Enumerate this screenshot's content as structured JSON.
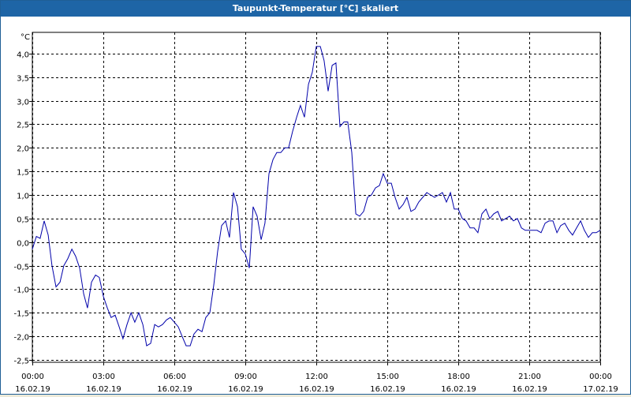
{
  "window": {
    "title": "Taupunkt-Temperatur [°C] skaliert"
  },
  "chart_data": {
    "type": "line",
    "title": "Taupunkt-Temperatur [°C] skaliert",
    "y_unit_label": "°C",
    "ylim": [
      -2.55,
      4.45
    ],
    "xlim_hours": [
      0,
      24
    ],
    "grid": true,
    "grid_style": "dashed",
    "line_color": "#0000aa",
    "y_ticks": [
      {
        "value": 4.0,
        "label": "4,0"
      },
      {
        "value": 3.5,
        "label": "3,5"
      },
      {
        "value": 3.0,
        "label": "3,0"
      },
      {
        "value": 2.5,
        "label": "2,5"
      },
      {
        "value": 2.0,
        "label": "2,0"
      },
      {
        "value": 1.5,
        "label": "1,5"
      },
      {
        "value": 1.0,
        "label": "1,0"
      },
      {
        "value": 0.5,
        "label": "0,5"
      },
      {
        "value": 0.0,
        "label": "0,0"
      },
      {
        "value": -0.5,
        "label": "-0,5"
      },
      {
        "value": -1.0,
        "label": "-1,0"
      },
      {
        "value": -1.5,
        "label": "-1,5"
      },
      {
        "value": -2.0,
        "label": "-2,0"
      },
      {
        "value": -2.5,
        "label": "-2,5"
      }
    ],
    "x_ticks": [
      {
        "hour": 0,
        "time": "00:00",
        "date": "16.02.19"
      },
      {
        "hour": 3,
        "time": "03:00",
        "date": "16.02.19"
      },
      {
        "hour": 6,
        "time": "06:00",
        "date": "16.02.19"
      },
      {
        "hour": 9,
        "time": "09:00",
        "date": "16.02.19"
      },
      {
        "hour": 12,
        "time": "12:00",
        "date": "16.02.19"
      },
      {
        "hour": 15,
        "time": "15:00",
        "date": "16.02.19"
      },
      {
        "hour": 18,
        "time": "18:00",
        "date": "16.02.19"
      },
      {
        "hour": 21,
        "time": "21:00",
        "date": "16.02.19"
      },
      {
        "hour": 24,
        "time": "00:00",
        "date": "17.02.19"
      }
    ],
    "series": [
      {
        "points": [
          [
            0.0,
            -0.15
          ],
          [
            0.17,
            0.12
          ],
          [
            0.33,
            0.08
          ],
          [
            0.5,
            0.45
          ],
          [
            0.67,
            0.15
          ],
          [
            0.83,
            -0.5
          ],
          [
            1.0,
            -0.95
          ],
          [
            1.17,
            -0.85
          ],
          [
            1.33,
            -0.5
          ],
          [
            1.5,
            -0.35
          ],
          [
            1.67,
            -0.15
          ],
          [
            1.83,
            -0.3
          ],
          [
            2.0,
            -0.55
          ],
          [
            2.17,
            -1.1
          ],
          [
            2.33,
            -1.4
          ],
          [
            2.5,
            -0.85
          ],
          [
            2.67,
            -0.7
          ],
          [
            2.83,
            -0.75
          ],
          [
            3.0,
            -1.15
          ],
          [
            3.17,
            -1.4
          ],
          [
            3.33,
            -1.6
          ],
          [
            3.5,
            -1.55
          ],
          [
            3.67,
            -1.8
          ],
          [
            3.83,
            -2.05
          ],
          [
            4.0,
            -1.75
          ],
          [
            4.17,
            -1.5
          ],
          [
            4.33,
            -1.7
          ],
          [
            4.5,
            -1.5
          ],
          [
            4.67,
            -1.75
          ],
          [
            4.83,
            -2.2
          ],
          [
            5.0,
            -2.15
          ],
          [
            5.17,
            -1.75
          ],
          [
            5.33,
            -1.8
          ],
          [
            5.5,
            -1.75
          ],
          [
            5.67,
            -1.65
          ],
          [
            5.83,
            -1.6
          ],
          [
            6.0,
            -1.7
          ],
          [
            6.17,
            -1.8
          ],
          [
            6.33,
            -2.0
          ],
          [
            6.5,
            -2.2
          ],
          [
            6.67,
            -2.2
          ],
          [
            6.83,
            -1.95
          ],
          [
            7.0,
            -1.85
          ],
          [
            7.17,
            -1.9
          ],
          [
            7.33,
            -1.6
          ],
          [
            7.5,
            -1.5
          ],
          [
            7.67,
            -0.9
          ],
          [
            7.83,
            -0.2
          ],
          [
            8.0,
            0.35
          ],
          [
            8.17,
            0.45
          ],
          [
            8.33,
            0.1
          ],
          [
            8.5,
            1.05
          ],
          [
            8.67,
            0.75
          ],
          [
            8.83,
            -0.15
          ],
          [
            9.0,
            -0.25
          ],
          [
            9.17,
            -0.55
          ],
          [
            9.33,
            0.75
          ],
          [
            9.5,
            0.55
          ],
          [
            9.67,
            0.05
          ],
          [
            9.83,
            0.4
          ],
          [
            10.0,
            1.45
          ],
          [
            10.17,
            1.75
          ],
          [
            10.33,
            1.9
          ],
          [
            10.5,
            1.9
          ],
          [
            10.67,
            2.0
          ],
          [
            10.83,
            2.0
          ],
          [
            11.0,
            2.35
          ],
          [
            11.17,
            2.65
          ],
          [
            11.33,
            2.9
          ],
          [
            11.5,
            2.65
          ],
          [
            11.67,
            3.35
          ],
          [
            11.83,
            3.6
          ],
          [
            12.0,
            4.15
          ],
          [
            12.17,
            4.15
          ],
          [
            12.33,
            3.85
          ],
          [
            12.5,
            3.2
          ],
          [
            12.67,
            3.75
          ],
          [
            12.83,
            3.8
          ],
          [
            13.0,
            2.45
          ],
          [
            13.17,
            2.55
          ],
          [
            13.33,
            2.55
          ],
          [
            13.5,
            1.9
          ],
          [
            13.67,
            0.6
          ],
          [
            13.83,
            0.55
          ],
          [
            14.0,
            0.65
          ],
          [
            14.17,
            0.95
          ],
          [
            14.33,
            1.0
          ],
          [
            14.5,
            1.15
          ],
          [
            14.67,
            1.2
          ],
          [
            14.83,
            1.45
          ],
          [
            15.0,
            1.25
          ],
          [
            15.17,
            1.25
          ],
          [
            15.33,
            0.95
          ],
          [
            15.5,
            0.7
          ],
          [
            15.67,
            0.8
          ],
          [
            15.83,
            0.95
          ],
          [
            16.0,
            0.65
          ],
          [
            16.17,
            0.7
          ],
          [
            16.33,
            0.85
          ],
          [
            16.5,
            0.95
          ],
          [
            16.67,
            1.05
          ],
          [
            16.83,
            1.0
          ],
          [
            17.0,
            0.95
          ],
          [
            17.17,
            1.0
          ],
          [
            17.33,
            1.05
          ],
          [
            17.5,
            0.85
          ],
          [
            17.67,
            1.05
          ],
          [
            17.83,
            0.7
          ],
          [
            18.0,
            0.7
          ],
          [
            18.17,
            0.5
          ],
          [
            18.33,
            0.45
          ],
          [
            18.5,
            0.3
          ],
          [
            18.67,
            0.3
          ],
          [
            18.83,
            0.2
          ],
          [
            19.0,
            0.6
          ],
          [
            19.17,
            0.7
          ],
          [
            19.33,
            0.5
          ],
          [
            19.5,
            0.6
          ],
          [
            19.67,
            0.65
          ],
          [
            19.83,
            0.45
          ],
          [
            20.0,
            0.5
          ],
          [
            20.17,
            0.55
          ],
          [
            20.33,
            0.45
          ],
          [
            20.5,
            0.5
          ],
          [
            20.67,
            0.3
          ],
          [
            20.83,
            0.25
          ],
          [
            21.0,
            0.25
          ],
          [
            21.17,
            0.25
          ],
          [
            21.33,
            0.25
          ],
          [
            21.5,
            0.2
          ],
          [
            21.67,
            0.4
          ],
          [
            21.83,
            0.45
          ],
          [
            22.0,
            0.45
          ],
          [
            22.17,
            0.2
          ],
          [
            22.33,
            0.35
          ],
          [
            22.5,
            0.4
          ],
          [
            22.67,
            0.25
          ],
          [
            22.83,
            0.15
          ],
          [
            23.0,
            0.3
          ],
          [
            23.17,
            0.45
          ],
          [
            23.33,
            0.25
          ],
          [
            23.5,
            0.1
          ],
          [
            23.67,
            0.2
          ],
          [
            23.83,
            0.2
          ],
          [
            24.0,
            0.25
          ]
        ]
      }
    ]
  }
}
